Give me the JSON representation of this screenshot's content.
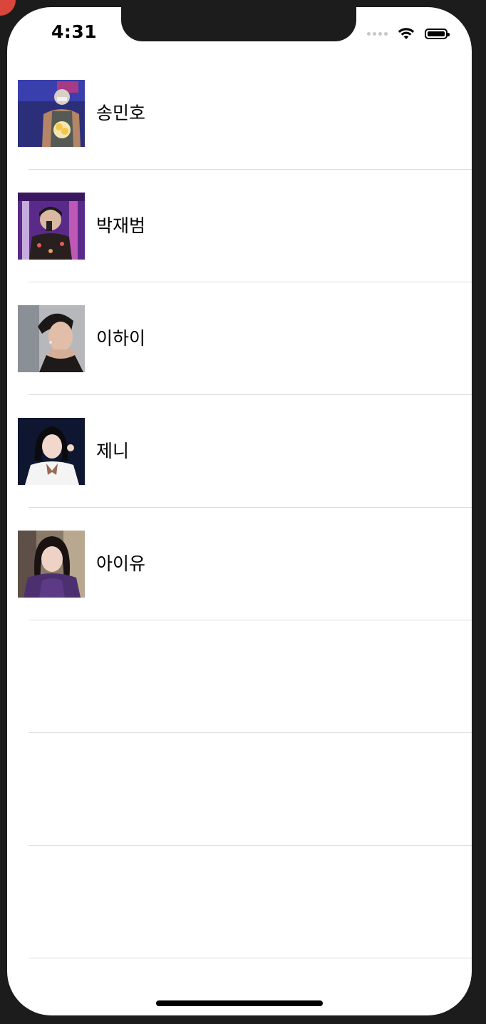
{
  "status_bar": {
    "time": "4:31"
  },
  "contacts": [
    {
      "name": "송민호",
      "avatar": "photo-songminho"
    },
    {
      "name": "박재범",
      "avatar": "photo-parkjaebeom"
    },
    {
      "name": "이하이",
      "avatar": "photo-leehi"
    },
    {
      "name": "제니",
      "avatar": "photo-jennie"
    },
    {
      "name": "아이유",
      "avatar": "photo-iu"
    }
  ],
  "empty_rows": 3,
  "colors": {
    "separator": "#dcdcdc",
    "device_frame": "#1c1c1c",
    "background": "#ffffff"
  }
}
